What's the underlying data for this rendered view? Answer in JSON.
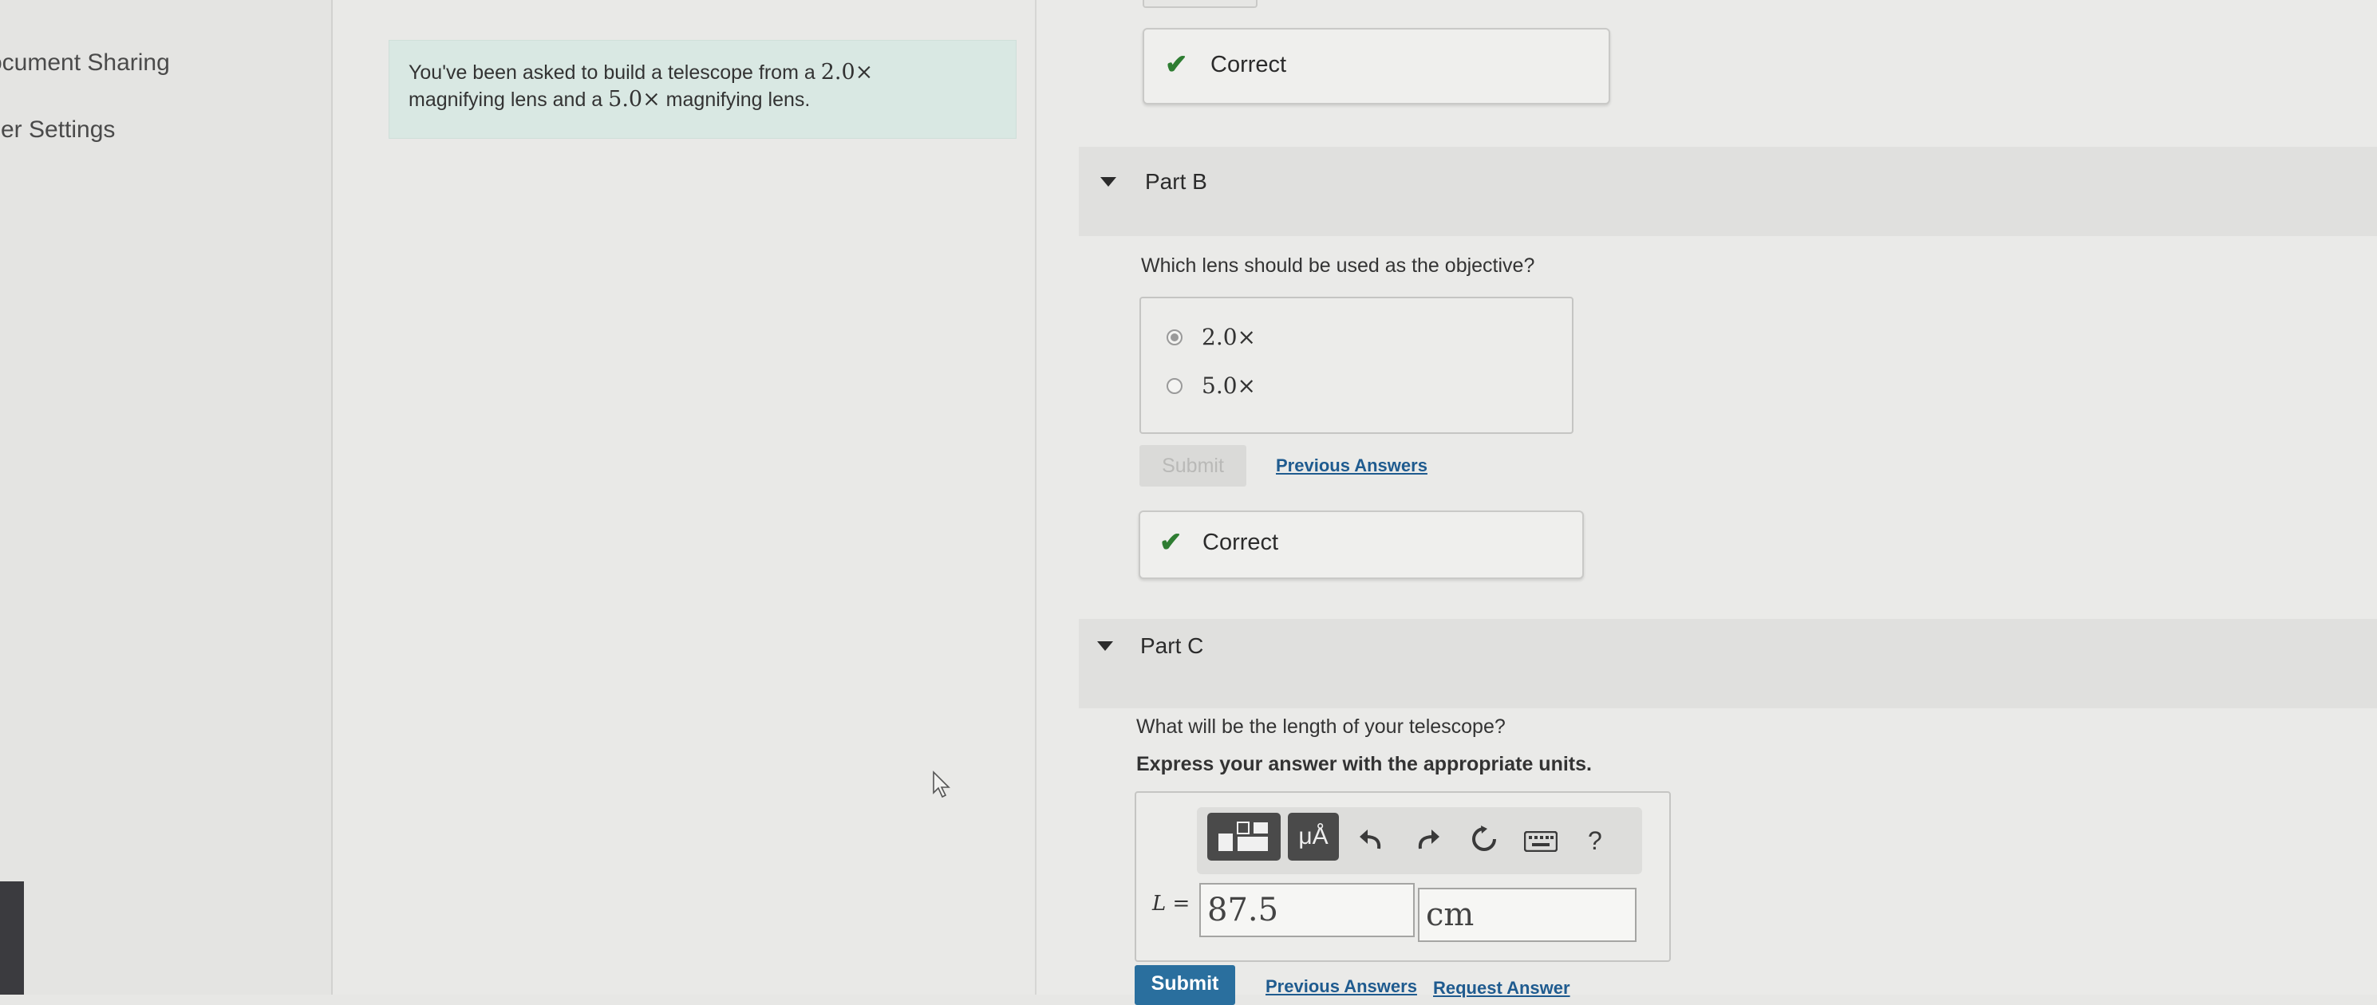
{
  "sidebar": {
    "items": [
      {
        "label": "ocument Sharing"
      },
      {
        "label": "ser Settings"
      }
    ]
  },
  "intro": {
    "text_before": "You've been asked to build a telescope from a ",
    "mag1": "2.0×",
    "text_middle": "magnifying lens and a ",
    "mag2": "5.0×",
    "text_after": " magnifying lens."
  },
  "partA": {
    "feedback": "Correct"
  },
  "partB": {
    "title": "Part B",
    "question": "Which lens should be used as the objective?",
    "options": [
      {
        "label": "2.0×",
        "selected": true
      },
      {
        "label": "5.0×",
        "selected": false
      }
    ],
    "submit_label": "Submit",
    "previous_answers": "Previous Answers",
    "feedback": "Correct"
  },
  "partC": {
    "title": "Part C",
    "question": "What will be the length of your telescope?",
    "instruction": "Express your answer with the appropriate units.",
    "toolbar": {
      "units_label": "μÅ",
      "help_label": "?",
      "icons": [
        "templates-icon",
        "units-icon",
        "undo-icon",
        "redo-icon",
        "reset-icon",
        "keyboard-icon",
        "help-icon"
      ]
    },
    "variable": "L =",
    "value": "87.5",
    "unit": "cm",
    "submit_label": "Submit",
    "previous_answers": "Previous Answers",
    "request_answer": "Request Answer"
  },
  "colors": {
    "accent": "#2a6f9e",
    "correct": "#2e7d32",
    "intro_bg": "#d9e8e3"
  }
}
